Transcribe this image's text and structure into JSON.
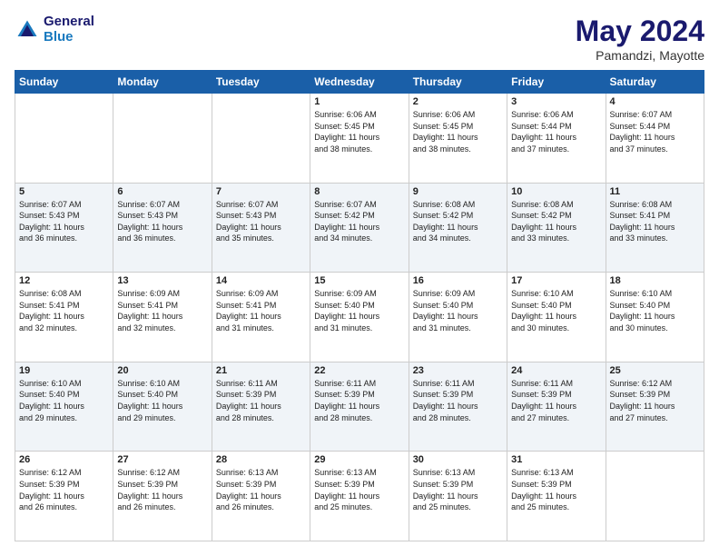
{
  "logo": {
    "line1": "General",
    "line2": "Blue"
  },
  "title": "May 2024",
  "subtitle": "Pamandzi, Mayotte",
  "days_of_week": [
    "Sunday",
    "Monday",
    "Tuesday",
    "Wednesday",
    "Thursday",
    "Friday",
    "Saturday"
  ],
  "weeks": [
    [
      {
        "day": "",
        "info": ""
      },
      {
        "day": "",
        "info": ""
      },
      {
        "day": "",
        "info": ""
      },
      {
        "day": "1",
        "info": "Sunrise: 6:06 AM\nSunset: 5:45 PM\nDaylight: 11 hours\nand 38 minutes."
      },
      {
        "day": "2",
        "info": "Sunrise: 6:06 AM\nSunset: 5:45 PM\nDaylight: 11 hours\nand 38 minutes."
      },
      {
        "day": "3",
        "info": "Sunrise: 6:06 AM\nSunset: 5:44 PM\nDaylight: 11 hours\nand 37 minutes."
      },
      {
        "day": "4",
        "info": "Sunrise: 6:07 AM\nSunset: 5:44 PM\nDaylight: 11 hours\nand 37 minutes."
      }
    ],
    [
      {
        "day": "5",
        "info": "Sunrise: 6:07 AM\nSunset: 5:43 PM\nDaylight: 11 hours\nand 36 minutes."
      },
      {
        "day": "6",
        "info": "Sunrise: 6:07 AM\nSunset: 5:43 PM\nDaylight: 11 hours\nand 36 minutes."
      },
      {
        "day": "7",
        "info": "Sunrise: 6:07 AM\nSunset: 5:43 PM\nDaylight: 11 hours\nand 35 minutes."
      },
      {
        "day": "8",
        "info": "Sunrise: 6:07 AM\nSunset: 5:42 PM\nDaylight: 11 hours\nand 34 minutes."
      },
      {
        "day": "9",
        "info": "Sunrise: 6:08 AM\nSunset: 5:42 PM\nDaylight: 11 hours\nand 34 minutes."
      },
      {
        "day": "10",
        "info": "Sunrise: 6:08 AM\nSunset: 5:42 PM\nDaylight: 11 hours\nand 33 minutes."
      },
      {
        "day": "11",
        "info": "Sunrise: 6:08 AM\nSunset: 5:41 PM\nDaylight: 11 hours\nand 33 minutes."
      }
    ],
    [
      {
        "day": "12",
        "info": "Sunrise: 6:08 AM\nSunset: 5:41 PM\nDaylight: 11 hours\nand 32 minutes."
      },
      {
        "day": "13",
        "info": "Sunrise: 6:09 AM\nSunset: 5:41 PM\nDaylight: 11 hours\nand 32 minutes."
      },
      {
        "day": "14",
        "info": "Sunrise: 6:09 AM\nSunset: 5:41 PM\nDaylight: 11 hours\nand 31 minutes."
      },
      {
        "day": "15",
        "info": "Sunrise: 6:09 AM\nSunset: 5:40 PM\nDaylight: 11 hours\nand 31 minutes."
      },
      {
        "day": "16",
        "info": "Sunrise: 6:09 AM\nSunset: 5:40 PM\nDaylight: 11 hours\nand 31 minutes."
      },
      {
        "day": "17",
        "info": "Sunrise: 6:10 AM\nSunset: 5:40 PM\nDaylight: 11 hours\nand 30 minutes."
      },
      {
        "day": "18",
        "info": "Sunrise: 6:10 AM\nSunset: 5:40 PM\nDaylight: 11 hours\nand 30 minutes."
      }
    ],
    [
      {
        "day": "19",
        "info": "Sunrise: 6:10 AM\nSunset: 5:40 PM\nDaylight: 11 hours\nand 29 minutes."
      },
      {
        "day": "20",
        "info": "Sunrise: 6:10 AM\nSunset: 5:40 PM\nDaylight: 11 hours\nand 29 minutes."
      },
      {
        "day": "21",
        "info": "Sunrise: 6:11 AM\nSunset: 5:39 PM\nDaylight: 11 hours\nand 28 minutes."
      },
      {
        "day": "22",
        "info": "Sunrise: 6:11 AM\nSunset: 5:39 PM\nDaylight: 11 hours\nand 28 minutes."
      },
      {
        "day": "23",
        "info": "Sunrise: 6:11 AM\nSunset: 5:39 PM\nDaylight: 11 hours\nand 28 minutes."
      },
      {
        "day": "24",
        "info": "Sunrise: 6:11 AM\nSunset: 5:39 PM\nDaylight: 11 hours\nand 27 minutes."
      },
      {
        "day": "25",
        "info": "Sunrise: 6:12 AM\nSunset: 5:39 PM\nDaylight: 11 hours\nand 27 minutes."
      }
    ],
    [
      {
        "day": "26",
        "info": "Sunrise: 6:12 AM\nSunset: 5:39 PM\nDaylight: 11 hours\nand 26 minutes."
      },
      {
        "day": "27",
        "info": "Sunrise: 6:12 AM\nSunset: 5:39 PM\nDaylight: 11 hours\nand 26 minutes."
      },
      {
        "day": "28",
        "info": "Sunrise: 6:13 AM\nSunset: 5:39 PM\nDaylight: 11 hours\nand 26 minutes."
      },
      {
        "day": "29",
        "info": "Sunrise: 6:13 AM\nSunset: 5:39 PM\nDaylight: 11 hours\nand 25 minutes."
      },
      {
        "day": "30",
        "info": "Sunrise: 6:13 AM\nSunset: 5:39 PM\nDaylight: 11 hours\nand 25 minutes."
      },
      {
        "day": "31",
        "info": "Sunrise: 6:13 AM\nSunset: 5:39 PM\nDaylight: 11 hours\nand 25 minutes."
      },
      {
        "day": "",
        "info": ""
      }
    ]
  ]
}
